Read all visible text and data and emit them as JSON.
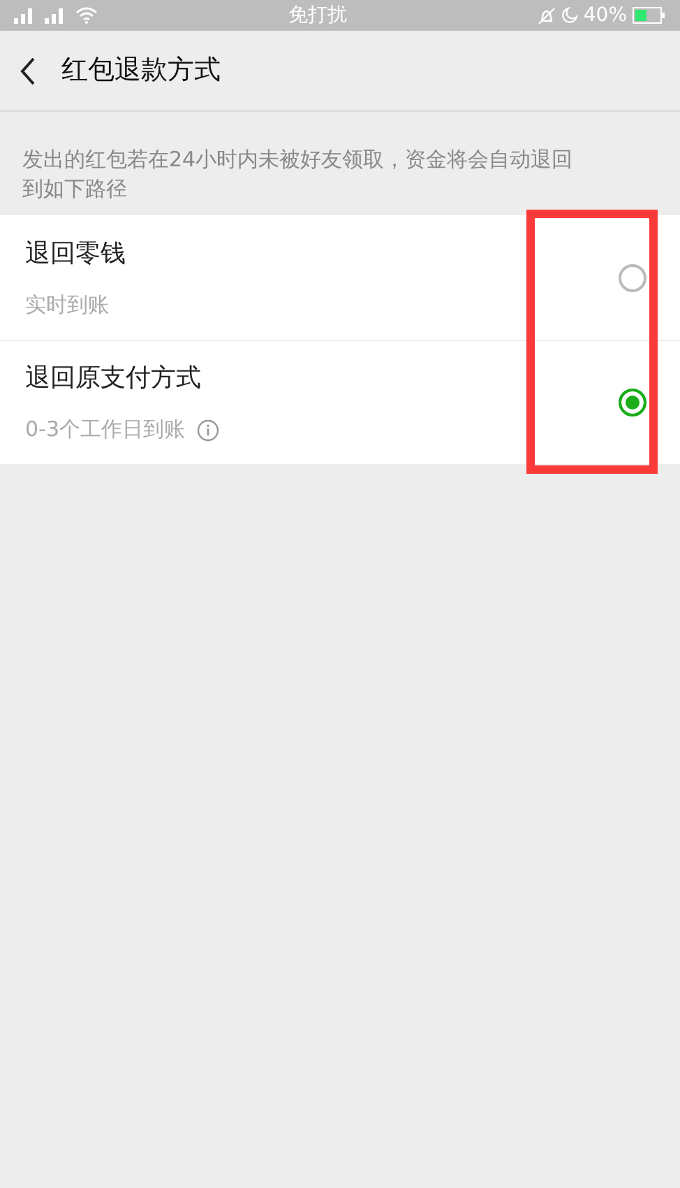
{
  "status_bar": {
    "center": "免打扰",
    "battery": "40%"
  },
  "header": {
    "title": "红包退款方式"
  },
  "description": "发出的红包若在24小时内未被好友领取，资金将会自动退回到如下路径",
  "options": [
    {
      "title": "退回零钱",
      "subtitle": "实时到账",
      "info": false,
      "selected": false
    },
    {
      "title": "退回原支付方式",
      "subtitle": "0-3个工作日到账",
      "info": true,
      "selected": true
    }
  ]
}
